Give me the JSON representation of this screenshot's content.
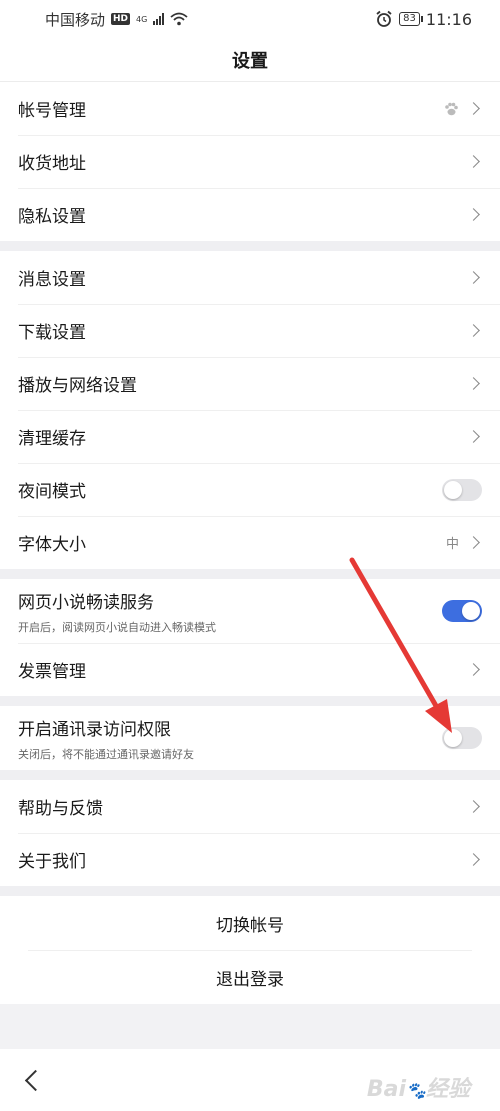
{
  "status_bar": {
    "carrier": "中国移动",
    "hd": "HD",
    "network": "4G",
    "battery": "83",
    "time": "11:16"
  },
  "header": {
    "title": "设置"
  },
  "group1": {
    "account": "帐号管理",
    "address": "收货地址",
    "privacy": "隐私设置"
  },
  "group2": {
    "message": "消息设置",
    "download": "下载设置",
    "playback": "播放与网络设置",
    "cache": "清理缓存",
    "night": "夜间模式",
    "night_on": false,
    "font": "字体大小",
    "font_value": "中"
  },
  "group3": {
    "novel": "网页小说畅读服务",
    "novel_sub": "开启后，阅读网页小说自动进入畅读模式",
    "novel_on": true,
    "invoice": "发票管理"
  },
  "group4": {
    "contacts": "开启通讯录访问权限",
    "contacts_sub": "关闭后，将不能通过通讯录邀请好友",
    "contacts_on": false
  },
  "group5": {
    "help": "帮助与反馈",
    "about": "关于我们"
  },
  "actions": {
    "switch": "切换帐号",
    "logout": "退出登录"
  },
  "colors": {
    "accent": "#3d6ee0",
    "annotation_arrow": "#e53935"
  },
  "watermark": "Bai 经验"
}
